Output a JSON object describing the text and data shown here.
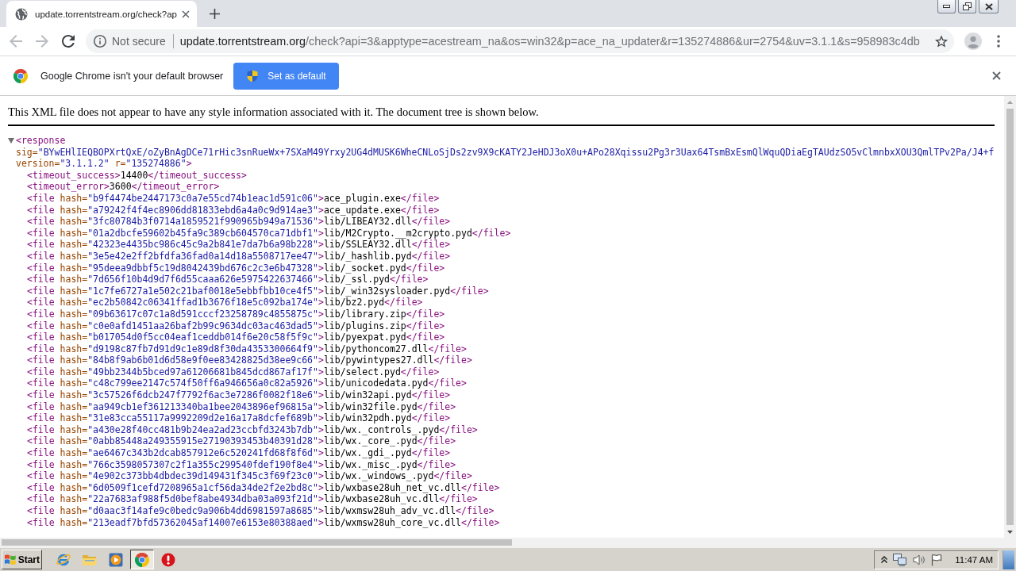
{
  "tabs": [
    {
      "title": "update.torrentstream.org/check?ap",
      "selected": true
    }
  ],
  "toolbar": {
    "back": {
      "disabled": true
    },
    "forward": {
      "disabled": true
    },
    "address": {
      "security_label": "Not secure",
      "host": "update.torrentstream.org",
      "path": "/check?api=3&apptype=acestream_na&os=win32&p=ace_na_updater&r=135274886&ur=2754&uv=3.1.1&s=958983c4db"
    }
  },
  "infobar": {
    "message": "Google Chrome isn't your default browser",
    "button": "Set as default"
  },
  "xml_viewer": {
    "notice": "This XML file does not appear to have any style information associated with it. The document tree is shown below.",
    "document": {
      "expanded": true,
      "open_lines": [
        {
          "tokens": [
            {
              "kind": "tag",
              "text": "<response"
            }
          ]
        },
        {
          "tokens": [
            {
              "kind": "attr",
              "text": "sig="
            },
            {
              "kind": "value",
              "text": "\"BYwEHlIEQBOPXrtQxE/oZyBnAgDCe71rHic3snRueWx+7SXaM49Yrxy2UG4dMUSK6WheCNLoSjDs2zv9X9cKATY2JeHDJ3oX0u+APo28Xqissu2Pg3r3Uax64TsmBxEsmQlWquQDiaEgTAUdzSO5vClmnbxXOU3QmlTPv2Pa/J4+f"
            }
          ]
        },
        {
          "tokens": [
            {
              "kind": "attr",
              "text": "version="
            },
            {
              "kind": "value",
              "text": "\"3.1.1.2\""
            },
            {
              "kind": "attr",
              "text": " r="
            },
            {
              "kind": "value",
              "text": "\"135274886\""
            },
            {
              "kind": "tag",
              "text": ">"
            }
          ]
        }
      ],
      "children": [
        {
          "tokens": [
            {
              "kind": "tag",
              "text": "<timeout_success>"
            },
            {
              "kind": "text",
              "text": "14400"
            },
            {
              "kind": "tag",
              "text": "</timeout_success>"
            }
          ]
        },
        {
          "tokens": [
            {
              "kind": "tag",
              "text": "<timeout_error>"
            },
            {
              "kind": "text",
              "text": "3600"
            },
            {
              "kind": "tag",
              "text": "</timeout_error>"
            }
          ]
        },
        {
          "tokens": [
            {
              "kind": "tag",
              "text": "<file"
            },
            {
              "kind": "attr",
              "text": " hash="
            },
            {
              "kind": "value",
              "text": "\"b9f4474be2447173c0a7e55cd74b1eac1d591c06\""
            },
            {
              "kind": "tag",
              "text": ">"
            },
            {
              "kind": "text",
              "text": "ace_plugin.exe"
            },
            {
              "kind": "tag",
              "text": "</file>"
            }
          ]
        },
        {
          "tokens": [
            {
              "kind": "tag",
              "text": "<file"
            },
            {
              "kind": "attr",
              "text": " hash="
            },
            {
              "kind": "value",
              "text": "\"a79242f4f4ec8906dd81833ebd6a4a0c9d914ae3\""
            },
            {
              "kind": "tag",
              "text": ">"
            },
            {
              "kind": "text",
              "text": "ace_update.exe"
            },
            {
              "kind": "tag",
              "text": "</file>"
            }
          ]
        },
        {
          "tokens": [
            {
              "kind": "tag",
              "text": "<file"
            },
            {
              "kind": "attr",
              "text": " hash="
            },
            {
              "kind": "value",
              "text": "\"3fc80784b3f0714a1859521f990965b949a71536\""
            },
            {
              "kind": "tag",
              "text": ">"
            },
            {
              "kind": "text",
              "text": "lib/LIBEAY32.dll"
            },
            {
              "kind": "tag",
              "text": "</file>"
            }
          ]
        },
        {
          "tokens": [
            {
              "kind": "tag",
              "text": "<file"
            },
            {
              "kind": "attr",
              "text": " hash="
            },
            {
              "kind": "value",
              "text": "\"01a2dbcfe59602b45fa9c389cb604570ca71dbf1\""
            },
            {
              "kind": "tag",
              "text": ">"
            },
            {
              "kind": "text",
              "text": "lib/M2Crypto.__m2crypto.pyd"
            },
            {
              "kind": "tag",
              "text": "</file>"
            }
          ]
        },
        {
          "tokens": [
            {
              "kind": "tag",
              "text": "<file"
            },
            {
              "kind": "attr",
              "text": " hash="
            },
            {
              "kind": "value",
              "text": "\"42323e4435bc986c45c9a2b841e7da7b6a98b228\""
            },
            {
              "kind": "tag",
              "text": ">"
            },
            {
              "kind": "text",
              "text": "lib/SSLEAY32.dll"
            },
            {
              "kind": "tag",
              "text": "</file>"
            }
          ]
        },
        {
          "tokens": [
            {
              "kind": "tag",
              "text": "<file"
            },
            {
              "kind": "attr",
              "text": " hash="
            },
            {
              "kind": "value",
              "text": "\"3e5e42e2ff2bfdfa36fad0a14d18a5508717ee47\""
            },
            {
              "kind": "tag",
              "text": ">"
            },
            {
              "kind": "text",
              "text": "lib/_hashlib.pyd"
            },
            {
              "kind": "tag",
              "text": "</file>"
            }
          ]
        },
        {
          "tokens": [
            {
              "kind": "tag",
              "text": "<file"
            },
            {
              "kind": "attr",
              "text": " hash="
            },
            {
              "kind": "value",
              "text": "\"95deea9dbbf5c19d8042439bd676c2c3e6b47328\""
            },
            {
              "kind": "tag",
              "text": ">"
            },
            {
              "kind": "text",
              "text": "lib/_socket.pyd"
            },
            {
              "kind": "tag",
              "text": "</file>"
            }
          ]
        },
        {
          "tokens": [
            {
              "kind": "tag",
              "text": "<file"
            },
            {
              "kind": "attr",
              "text": " hash="
            },
            {
              "kind": "value",
              "text": "\"7d656f10b4d9d7f6d55caaa626e5975422637466\""
            },
            {
              "kind": "tag",
              "text": ">"
            },
            {
              "kind": "text",
              "text": "lib/_ssl.pyd"
            },
            {
              "kind": "tag",
              "text": "</file>"
            }
          ]
        },
        {
          "tokens": [
            {
              "kind": "tag",
              "text": "<file"
            },
            {
              "kind": "attr",
              "text": " hash="
            },
            {
              "kind": "value",
              "text": "\"1c7fe6727a1e502c21baf0018e5ebbfbb10ce4f5\""
            },
            {
              "kind": "tag",
              "text": ">"
            },
            {
              "kind": "text",
              "text": "lib/_win32sysloader.pyd"
            },
            {
              "kind": "tag",
              "text": "</file>"
            }
          ]
        },
        {
          "tokens": [
            {
              "kind": "tag",
              "text": "<file"
            },
            {
              "kind": "attr",
              "text": " hash="
            },
            {
              "kind": "value",
              "text": "\"ec2b50842c06341ffad1b3676f18e5c092ba174e\""
            },
            {
              "kind": "tag",
              "text": ">"
            },
            {
              "kind": "text",
              "text": "lib/bz2.pyd"
            },
            {
              "kind": "tag",
              "text": "</file>"
            }
          ]
        },
        {
          "tokens": [
            {
              "kind": "tag",
              "text": "<file"
            },
            {
              "kind": "attr",
              "text": " hash="
            },
            {
              "kind": "value",
              "text": "\"09b63617c07c1a8d591cccf23258789c4855875c\""
            },
            {
              "kind": "tag",
              "text": ">"
            },
            {
              "kind": "text",
              "text": "lib/library.zip"
            },
            {
              "kind": "tag",
              "text": "</file>"
            }
          ]
        },
        {
          "tokens": [
            {
              "kind": "tag",
              "text": "<file"
            },
            {
              "kind": "attr",
              "text": " hash="
            },
            {
              "kind": "value",
              "text": "\"c0e0afd1451aa26baf2b99c9634dc03ac463dad5\""
            },
            {
              "kind": "tag",
              "text": ">"
            },
            {
              "kind": "text",
              "text": "lib/plugins.zip"
            },
            {
              "kind": "tag",
              "text": "</file>"
            }
          ]
        },
        {
          "tokens": [
            {
              "kind": "tag",
              "text": "<file"
            },
            {
              "kind": "attr",
              "text": " hash="
            },
            {
              "kind": "value",
              "text": "\"b017054d0f5cc04eaf1ceddb014f6e20c58f5f9c\""
            },
            {
              "kind": "tag",
              "text": ">"
            },
            {
              "kind": "text",
              "text": "lib/pyexpat.pyd"
            },
            {
              "kind": "tag",
              "text": "</file>"
            }
          ]
        },
        {
          "tokens": [
            {
              "kind": "tag",
              "text": "<file"
            },
            {
              "kind": "attr",
              "text": " hash="
            },
            {
              "kind": "value",
              "text": "\"d9198c87fb7d91d9c1e89d8f30da4353300664f9\""
            },
            {
              "kind": "tag",
              "text": ">"
            },
            {
              "kind": "text",
              "text": "lib/pythoncom27.dll"
            },
            {
              "kind": "tag",
              "text": "</file>"
            }
          ]
        },
        {
          "tokens": [
            {
              "kind": "tag",
              "text": "<file"
            },
            {
              "kind": "attr",
              "text": " hash="
            },
            {
              "kind": "value",
              "text": "\"84b8f9ab6b01d6d58e9f0ee83428825d38ee9c66\""
            },
            {
              "kind": "tag",
              "text": ">"
            },
            {
              "kind": "text",
              "text": "lib/pywintypes27.dll"
            },
            {
              "kind": "tag",
              "text": "</file>"
            }
          ]
        },
        {
          "tokens": [
            {
              "kind": "tag",
              "text": "<file"
            },
            {
              "kind": "attr",
              "text": " hash="
            },
            {
              "kind": "value",
              "text": "\"49bb2344b5bced97a61206681b845dcd867af17f\""
            },
            {
              "kind": "tag",
              "text": ">"
            },
            {
              "kind": "text",
              "text": "lib/select.pyd"
            },
            {
              "kind": "tag",
              "text": "</file>"
            }
          ]
        },
        {
          "tokens": [
            {
              "kind": "tag",
              "text": "<file"
            },
            {
              "kind": "attr",
              "text": " hash="
            },
            {
              "kind": "value",
              "text": "\"c48c799ee2147c574f50ff6a946656a0c82a5926\""
            },
            {
              "kind": "tag",
              "text": ">"
            },
            {
              "kind": "text",
              "text": "lib/unicodedata.pyd"
            },
            {
              "kind": "tag",
              "text": "</file>"
            }
          ]
        },
        {
          "tokens": [
            {
              "kind": "tag",
              "text": "<file"
            },
            {
              "kind": "attr",
              "text": " hash="
            },
            {
              "kind": "value",
              "text": "\"3c57526f6dcb247f7792f6ac3e7286f0082f18e6\""
            },
            {
              "kind": "tag",
              "text": ">"
            },
            {
              "kind": "text",
              "text": "lib/win32api.pyd"
            },
            {
              "kind": "tag",
              "text": "</file>"
            }
          ]
        },
        {
          "tokens": [
            {
              "kind": "tag",
              "text": "<file"
            },
            {
              "kind": "attr",
              "text": " hash="
            },
            {
              "kind": "value",
              "text": "\"aa949cb1ef361213340ba1bee2043896ef96815a\""
            },
            {
              "kind": "tag",
              "text": ">"
            },
            {
              "kind": "text",
              "text": "lib/win32file.pyd"
            },
            {
              "kind": "tag",
              "text": "</file>"
            }
          ]
        },
        {
          "tokens": [
            {
              "kind": "tag",
              "text": "<file"
            },
            {
              "kind": "attr",
              "text": " hash="
            },
            {
              "kind": "value",
              "text": "\"31e83cca55117a9992209d2e16a17a8dcfef689b\""
            },
            {
              "kind": "tag",
              "text": ">"
            },
            {
              "kind": "text",
              "text": "lib/win32pdh.pyd"
            },
            {
              "kind": "tag",
              "text": "</file>"
            }
          ]
        },
        {
          "tokens": [
            {
              "kind": "tag",
              "text": "<file"
            },
            {
              "kind": "attr",
              "text": " hash="
            },
            {
              "kind": "value",
              "text": "\"a430e28f40cc481b9b24ea2ad23ccbfd3243b7db\""
            },
            {
              "kind": "tag",
              "text": ">"
            },
            {
              "kind": "text",
              "text": "lib/wx._controls_.pyd"
            },
            {
              "kind": "tag",
              "text": "</file>"
            }
          ]
        },
        {
          "tokens": [
            {
              "kind": "tag",
              "text": "<file"
            },
            {
              "kind": "attr",
              "text": " hash="
            },
            {
              "kind": "value",
              "text": "\"0abb85448a249355915e27190393453b40391d28\""
            },
            {
              "kind": "tag",
              "text": ">"
            },
            {
              "kind": "text",
              "text": "lib/wx._core_.pyd"
            },
            {
              "kind": "tag",
              "text": "</file>"
            }
          ]
        },
        {
          "tokens": [
            {
              "kind": "tag",
              "text": "<file"
            },
            {
              "kind": "attr",
              "text": " hash="
            },
            {
              "kind": "value",
              "text": "\"ae6467c343b2dcab857912e6c520241fd68f8f6d\""
            },
            {
              "kind": "tag",
              "text": ">"
            },
            {
              "kind": "text",
              "text": "lib/wx._gdi_.pyd"
            },
            {
              "kind": "tag",
              "text": "</file>"
            }
          ]
        },
        {
          "tokens": [
            {
              "kind": "tag",
              "text": "<file"
            },
            {
              "kind": "attr",
              "text": " hash="
            },
            {
              "kind": "value",
              "text": "\"766c3598057307c2f1a355c299540fdef190f8e4\""
            },
            {
              "kind": "tag",
              "text": ">"
            },
            {
              "kind": "text",
              "text": "lib/wx._misc_.pyd"
            },
            {
              "kind": "tag",
              "text": "</file>"
            }
          ]
        },
        {
          "tokens": [
            {
              "kind": "tag",
              "text": "<file"
            },
            {
              "kind": "attr",
              "text": " hash="
            },
            {
              "kind": "value",
              "text": "\"4e902c373bb4dbdec39d149431f345c3f69f23c0\""
            },
            {
              "kind": "tag",
              "text": ">"
            },
            {
              "kind": "text",
              "text": "lib/wx._windows_.pyd"
            },
            {
              "kind": "tag",
              "text": "</file>"
            }
          ]
        },
        {
          "tokens": [
            {
              "kind": "tag",
              "text": "<file"
            },
            {
              "kind": "attr",
              "text": " hash="
            },
            {
              "kind": "value",
              "text": "\"6d0509f1cefd7208965a1cf56da34de2f2e2bd8c\""
            },
            {
              "kind": "tag",
              "text": ">"
            },
            {
              "kind": "text",
              "text": "lib/wxbase28uh_net_vc.dll"
            },
            {
              "kind": "tag",
              "text": "</file>"
            }
          ]
        },
        {
          "tokens": [
            {
              "kind": "tag",
              "text": "<file"
            },
            {
              "kind": "attr",
              "text": " hash="
            },
            {
              "kind": "value",
              "text": "\"22a7683af988f5d0bef8abe4934dba03a093f21d\""
            },
            {
              "kind": "tag",
              "text": ">"
            },
            {
              "kind": "text",
              "text": "lib/wxbase28uh_vc.dll"
            },
            {
              "kind": "tag",
              "text": "</file>"
            }
          ]
        },
        {
          "tokens": [
            {
              "kind": "tag",
              "text": "<file"
            },
            {
              "kind": "attr",
              "text": " hash="
            },
            {
              "kind": "value",
              "text": "\"d0aac3f14afe9c0bedc9a906b4dd6981597a8685\""
            },
            {
              "kind": "tag",
              "text": ">"
            },
            {
              "kind": "text",
              "text": "lib/wxmsw28uh_adv_vc.dll"
            },
            {
              "kind": "tag",
              "text": "</file>"
            }
          ]
        },
        {
          "tokens": [
            {
              "kind": "tag",
              "text": "<file"
            },
            {
              "kind": "attr",
              "text": " hash="
            },
            {
              "kind": "value",
              "text": "\"213eadf7bfd57362045af14007e6153e80388aed\""
            },
            {
              "kind": "tag",
              "text": ">"
            },
            {
              "kind": "text",
              "text": "lib/wxmsw28uh_core_vc.dll"
            },
            {
              "kind": "tag",
              "text": "</file>"
            }
          ]
        }
      ]
    }
  },
  "taskbar": {
    "start_label": "Start",
    "apps": [
      {
        "kind": "internet_explorer",
        "selected": false
      },
      {
        "kind": "file_explorer",
        "selected": false
      },
      {
        "kind": "media_player",
        "selected": false
      },
      {
        "kind": "chrome",
        "selected": true
      },
      {
        "kind": "alert_app",
        "selected": false
      }
    ],
    "clock": "11:47 AM"
  }
}
